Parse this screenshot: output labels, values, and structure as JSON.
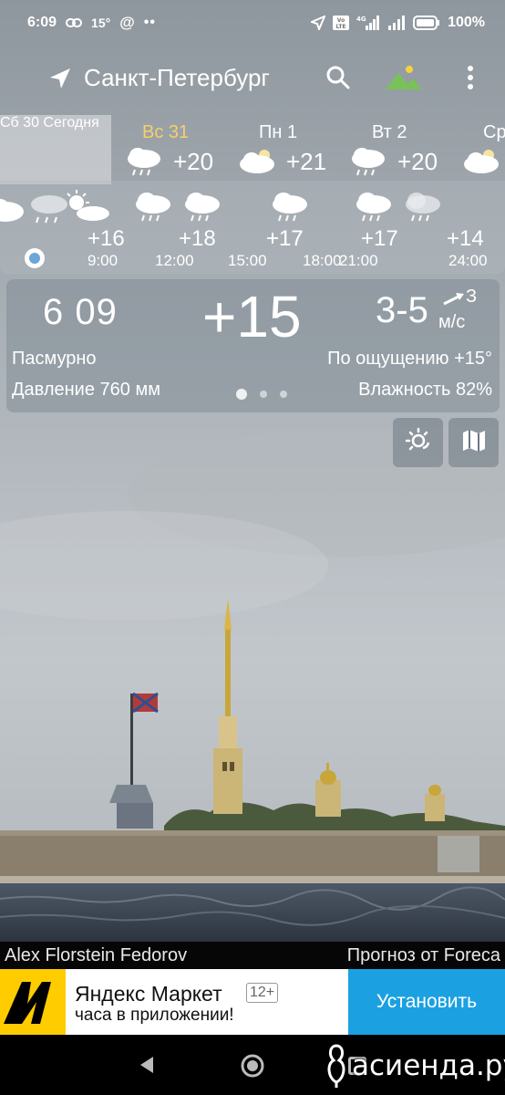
{
  "status_bar": {
    "time": "6:09",
    "temp_badge": "15°",
    "battery": "100%",
    "network": "4G"
  },
  "app_bar": {
    "city": "Санкт-Петербург",
    "icons": [
      "location-arrow-icon",
      "search-icon",
      "landscape-theme-icon",
      "more-vert-icon"
    ]
  },
  "days": [
    {
      "name": "Сб 30",
      "sub": "Сегодня",
      "selected": true,
      "weekend": true
    },
    {
      "name": "Вс 31",
      "temp": "+20",
      "icon": "rain-cloud-icon",
      "weekend": true
    },
    {
      "name": "Пн 1",
      "temp": "+21",
      "icon": "cloud-icon",
      "weekend": false
    },
    {
      "name": "Вт 2",
      "temp": "+20",
      "icon": "rain-cloud-icon",
      "weekend": false
    },
    {
      "name": "Ср",
      "icon": "cloud-icon",
      "weekend": false
    }
  ],
  "hourly": [
    {
      "hour": "9:00",
      "temp": "+16",
      "icon": "rain-cloud-icon"
    },
    {
      "hour": "12:00",
      "temp": "+18",
      "icon": "rain-cloud-icon"
    },
    {
      "hour": "15:00",
      "temp": "+17",
      "icon": "rain-cloud-icon"
    },
    {
      "hour": "18:00",
      "temp": "+17",
      "icon": "rain-cloud-icon"
    },
    {
      "hour": "21:00",
      "temp": "+17",
      "icon": "rain-cloud-icon"
    },
    {
      "hour": "24:00",
      "temp": "+14",
      "icon": "rain-cloud-icon"
    }
  ],
  "current": {
    "time": "6 09",
    "temp": "+15",
    "wind_speed": "3-5",
    "wind_dir": "З",
    "wind_unit": "м/с",
    "condition": "Пасмурно",
    "feels_like": "По ощущению +15°",
    "pressure": "Давление 760 мм",
    "humidity": "Влажность 82%",
    "page_indicator": {
      "count": 3,
      "active": 0
    }
  },
  "actions": [
    "sun-radar-icon",
    "map-icon"
  ],
  "photo_caption": {
    "author": "Alex Florstein Fedorov",
    "source": "Прогноз от Foreca"
  },
  "ad": {
    "title": "Яндекс Маркет",
    "age": "12+",
    "subtitle": "часа в приложении!",
    "button": "Установить",
    "brand_color": "#ffcc00",
    "button_color": "#1ba1e2"
  },
  "watermark": "асиенда.ру"
}
